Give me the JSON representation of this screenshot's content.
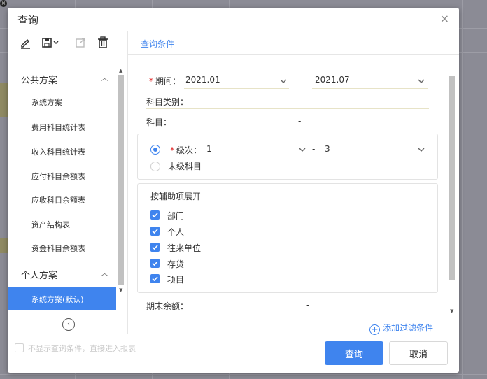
{
  "dialog": {
    "title": "查询",
    "close_symbol": "×"
  },
  "toolbar": {
    "icons": [
      "edit-icon",
      "save-icon",
      "export-icon",
      "delete-icon"
    ]
  },
  "sidebar": {
    "public_section": {
      "label": "公共方案",
      "items": [
        "系统方案",
        "费用科目统计表",
        "收入科目统计表",
        "应付科目余额表",
        "应收科目余额表",
        "资产结构表",
        "资金科目余额表"
      ]
    },
    "personal_section": {
      "label": "个人方案",
      "items": [
        "系统方案(默认)"
      ]
    }
  },
  "query": {
    "tab_label": "查询条件",
    "period": {
      "label": "期间：",
      "from": "2021.01",
      "dash": "-",
      "to": "2021.07"
    },
    "subject_category": {
      "label": "科目类别："
    },
    "subject": {
      "label": "科目：",
      "dash": "-"
    },
    "level": {
      "label": "级次：",
      "from": "1",
      "dash": "-",
      "to": "3"
    },
    "last_level": {
      "label": "末级科目"
    },
    "aux_group": {
      "title": "按辅助项展开",
      "items": [
        "部门",
        "个人",
        "往来单位",
        "存货",
        "项目"
      ]
    },
    "end_balance": {
      "label": "期末余额：",
      "dash": "-"
    },
    "add_filter": "添加过滤条件"
  },
  "footer": {
    "skip_label": "不显示查询条件，直接进入报表",
    "query_button": "查询",
    "cancel_button": "取消"
  },
  "colors": {
    "accent": "#3f84ee",
    "required": "#e02020"
  }
}
